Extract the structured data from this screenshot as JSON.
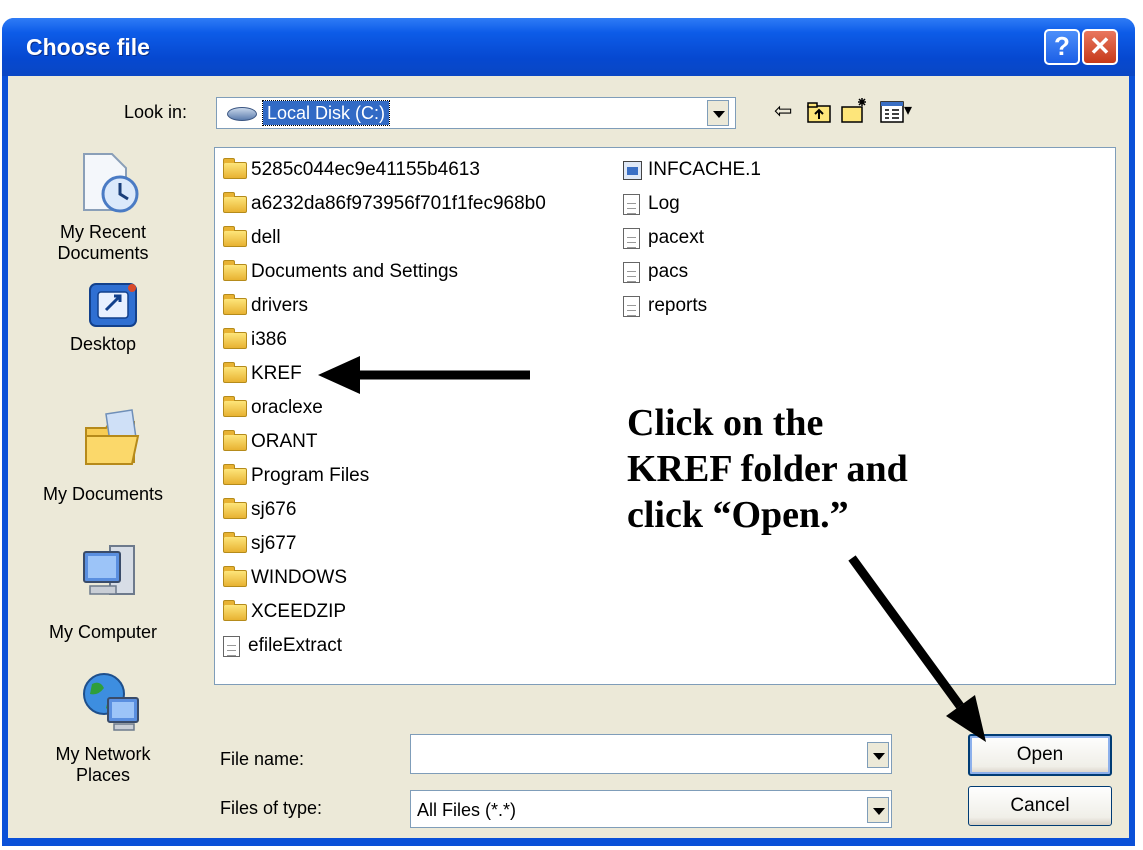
{
  "window": {
    "title": "Choose file",
    "help_glyph": "?",
    "close_glyph": "✕"
  },
  "look_in": {
    "label": "Look in:",
    "value": "Local Disk (C:)"
  },
  "toolbar": {
    "back_glyph": "⇦",
    "views_arrow": "▾"
  },
  "places": [
    {
      "label": "My Recent Documents",
      "lines": [
        "My Recent",
        "Documents"
      ],
      "icon": "recent-documents-icon"
    },
    {
      "label": "Desktop",
      "lines": [
        "Desktop"
      ],
      "icon": "desktop-icon"
    },
    {
      "label": "My Documents",
      "lines": [
        "My Documents"
      ],
      "icon": "my-documents-icon"
    },
    {
      "label": "My Computer",
      "lines": [
        "My Computer"
      ],
      "icon": "my-computer-icon"
    },
    {
      "label": "My Network Places",
      "lines": [
        "My Network",
        "Places"
      ],
      "icon": "network-places-icon"
    }
  ],
  "files": {
    "column1": [
      {
        "name": "5285c044ec9e41155b4613",
        "type": "folder"
      },
      {
        "name": "a6232da86f973956f701f1fec968b0",
        "type": "folder"
      },
      {
        "name": "dell",
        "type": "folder"
      },
      {
        "name": "Documents and Settings",
        "type": "folder"
      },
      {
        "name": "drivers",
        "type": "folder"
      },
      {
        "name": "i386",
        "type": "folder"
      },
      {
        "name": "KREF",
        "type": "folder"
      },
      {
        "name": "oraclexe",
        "type": "folder"
      },
      {
        "name": "ORANT",
        "type": "folder"
      },
      {
        "name": "Program Files",
        "type": "folder"
      },
      {
        "name": "sj676",
        "type": "folder"
      },
      {
        "name": "sj677",
        "type": "folder"
      },
      {
        "name": "WINDOWS",
        "type": "folder"
      },
      {
        "name": "XCEEDZIP",
        "type": "folder"
      },
      {
        "name": "efileExtract",
        "type": "document"
      }
    ],
    "column2": [
      {
        "name": "INFCACHE.1",
        "type": "system"
      },
      {
        "name": "Log",
        "type": "document"
      },
      {
        "name": "pacext",
        "type": "document"
      },
      {
        "name": "pacs",
        "type": "document"
      },
      {
        "name": "reports",
        "type": "document"
      }
    ]
  },
  "file_name": {
    "label": "File name:",
    "value": ""
  },
  "file_type": {
    "label": "Files of type:",
    "value": "All Files (*.*)"
  },
  "buttons": {
    "open": "Open",
    "cancel": "Cancel"
  },
  "annotation": {
    "lines": [
      "Click on the",
      "KREF folder and",
      "click “Open.”"
    ]
  }
}
